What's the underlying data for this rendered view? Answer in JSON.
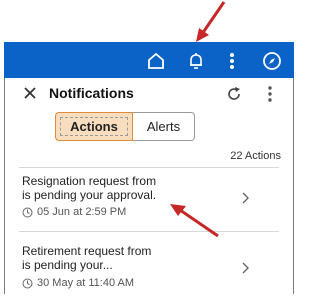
{
  "topbar": {
    "icons": [
      "home-icon",
      "bell-icon",
      "more-vertical-icon",
      "compass-icon"
    ],
    "color": "#0b63c8"
  },
  "panel": {
    "title": "Notifications",
    "tabs": [
      {
        "label": "Actions",
        "selected": true
      },
      {
        "label": "Alerts",
        "selected": false
      }
    ],
    "actions_count": "22 Actions"
  },
  "notifications": [
    {
      "line1": "Resignation request from",
      "line2": "is pending your approval.",
      "time": "05 Jun at 2:59 PM"
    },
    {
      "line1": "Retirement request from",
      "line2": "is pending your...",
      "time": "30 May at 11:40 AM"
    }
  ],
  "annotation": {
    "arrow_color": "#c62828"
  }
}
